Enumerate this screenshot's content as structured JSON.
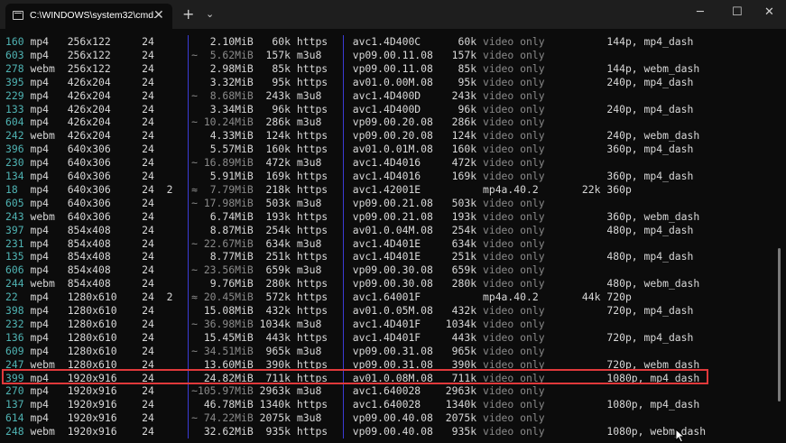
{
  "window": {
    "tab_title": "C:\\WINDOWS\\system32\\cmd.",
    "close_tab": "✕",
    "new_tab": "+",
    "dropdown": "⌄",
    "minimize": "─",
    "maximize": "☐",
    "close": "✕"
  },
  "separators": {
    "bar": "|",
    "tilde": "~",
    "approx": "≈"
  },
  "rows": [
    {
      "id": "160",
      "ext": "mp4",
      "res": "256x122",
      "fps": "24",
      "ch": "",
      "tilde": "",
      "size": "2.10MiB",
      "tbr": "60k",
      "proto": "https",
      "vcodec": "avc1.4D400C",
      "vbr": "60k",
      "acodec": "video only",
      "abr": "",
      "more": "144p, mp4_dash"
    },
    {
      "id": "603",
      "ext": "mp4",
      "res": "256x122",
      "fps": "24",
      "ch": "",
      "tilde": "~",
      "size": "5.62MiB",
      "tbr": "157k",
      "proto": "m3u8",
      "vcodec": "vp09.00.11.08",
      "vbr": "157k",
      "acodec": "video only",
      "abr": "",
      "more": ""
    },
    {
      "id": "278",
      "ext": "webm",
      "res": "256x122",
      "fps": "24",
      "ch": "",
      "tilde": "",
      "size": "2.98MiB",
      "tbr": "85k",
      "proto": "https",
      "vcodec": "vp09.00.11.08",
      "vbr": "85k",
      "acodec": "video only",
      "abr": "",
      "more": "144p, webm_dash"
    },
    {
      "id": "395",
      "ext": "mp4",
      "res": "426x204",
      "fps": "24",
      "ch": "",
      "tilde": "",
      "size": "3.32MiB",
      "tbr": "95k",
      "proto": "https",
      "vcodec": "av01.0.00M.08",
      "vbr": "95k",
      "acodec": "video only",
      "abr": "",
      "more": "240p, mp4_dash"
    },
    {
      "id": "229",
      "ext": "mp4",
      "res": "426x204",
      "fps": "24",
      "ch": "",
      "tilde": "~",
      "size": "8.68MiB",
      "tbr": "243k",
      "proto": "m3u8",
      "vcodec": "avc1.4D400D",
      "vbr": "243k",
      "acodec": "video only",
      "abr": "",
      "more": ""
    },
    {
      "id": "133",
      "ext": "mp4",
      "res": "426x204",
      "fps": "24",
      "ch": "",
      "tilde": "",
      "size": "3.34MiB",
      "tbr": "96k",
      "proto": "https",
      "vcodec": "avc1.4D400D",
      "vbr": "96k",
      "acodec": "video only",
      "abr": "",
      "more": "240p, mp4_dash"
    },
    {
      "id": "604",
      "ext": "mp4",
      "res": "426x204",
      "fps": "24",
      "ch": "",
      "tilde": "~",
      "size": "10.24MiB",
      "tbr": "286k",
      "proto": "m3u8",
      "vcodec": "vp09.00.20.08",
      "vbr": "286k",
      "acodec": "video only",
      "abr": "",
      "more": ""
    },
    {
      "id": "242",
      "ext": "webm",
      "res": "426x204",
      "fps": "24",
      "ch": "",
      "tilde": "",
      "size": "4.33MiB",
      "tbr": "124k",
      "proto": "https",
      "vcodec": "vp09.00.20.08",
      "vbr": "124k",
      "acodec": "video only",
      "abr": "",
      "more": "240p, webm_dash"
    },
    {
      "id": "396",
      "ext": "mp4",
      "res": "640x306",
      "fps": "24",
      "ch": "",
      "tilde": "",
      "size": "5.57MiB",
      "tbr": "160k",
      "proto": "https",
      "vcodec": "av01.0.01M.08",
      "vbr": "160k",
      "acodec": "video only",
      "abr": "",
      "more": "360p, mp4_dash"
    },
    {
      "id": "230",
      "ext": "mp4",
      "res": "640x306",
      "fps": "24",
      "ch": "",
      "tilde": "~",
      "size": "16.89MiB",
      "tbr": "472k",
      "proto": "m3u8",
      "vcodec": "avc1.4D4016",
      "vbr": "472k",
      "acodec": "video only",
      "abr": "",
      "more": ""
    },
    {
      "id": "134",
      "ext": "mp4",
      "res": "640x306",
      "fps": "24",
      "ch": "",
      "tilde": "",
      "size": "5.91MiB",
      "tbr": "169k",
      "proto": "https",
      "vcodec": "avc1.4D4016",
      "vbr": "169k",
      "acodec": "video only",
      "abr": "",
      "more": "360p, mp4_dash"
    },
    {
      "id": "18",
      "ext": "mp4",
      "res": "640x306",
      "fps": "24",
      "ch": "2",
      "tilde": "≈",
      "size": "7.79MiB",
      "tbr": "218k",
      "proto": "https",
      "vcodec": "avc1.42001E",
      "vbr": "",
      "acodec": "mp4a.40.2",
      "abr": "22k",
      "more": "360p"
    },
    {
      "id": "605",
      "ext": "mp4",
      "res": "640x306",
      "fps": "24",
      "ch": "",
      "tilde": "~",
      "size": "17.98MiB",
      "tbr": "503k",
      "proto": "m3u8",
      "vcodec": "vp09.00.21.08",
      "vbr": "503k",
      "acodec": "video only",
      "abr": "",
      "more": ""
    },
    {
      "id": "243",
      "ext": "webm",
      "res": "640x306",
      "fps": "24",
      "ch": "",
      "tilde": "",
      "size": "6.74MiB",
      "tbr": "193k",
      "proto": "https",
      "vcodec": "vp09.00.21.08",
      "vbr": "193k",
      "acodec": "video only",
      "abr": "",
      "more": "360p, webm_dash"
    },
    {
      "id": "397",
      "ext": "mp4",
      "res": "854x408",
      "fps": "24",
      "ch": "",
      "tilde": "",
      "size": "8.87MiB",
      "tbr": "254k",
      "proto": "https",
      "vcodec": "av01.0.04M.08",
      "vbr": "254k",
      "acodec": "video only",
      "abr": "",
      "more": "480p, mp4_dash"
    },
    {
      "id": "231",
      "ext": "mp4",
      "res": "854x408",
      "fps": "24",
      "ch": "",
      "tilde": "~",
      "size": "22.67MiB",
      "tbr": "634k",
      "proto": "m3u8",
      "vcodec": "avc1.4D401E",
      "vbr": "634k",
      "acodec": "video only",
      "abr": "",
      "more": ""
    },
    {
      "id": "135",
      "ext": "mp4",
      "res": "854x408",
      "fps": "24",
      "ch": "",
      "tilde": "",
      "size": "8.77MiB",
      "tbr": "251k",
      "proto": "https",
      "vcodec": "avc1.4D401E",
      "vbr": "251k",
      "acodec": "video only",
      "abr": "",
      "more": "480p, mp4_dash"
    },
    {
      "id": "606",
      "ext": "mp4",
      "res": "854x408",
      "fps": "24",
      "ch": "",
      "tilde": "~",
      "size": "23.56MiB",
      "tbr": "659k",
      "proto": "m3u8",
      "vcodec": "vp09.00.30.08",
      "vbr": "659k",
      "acodec": "video only",
      "abr": "",
      "more": ""
    },
    {
      "id": "244",
      "ext": "webm",
      "res": "854x408",
      "fps": "24",
      "ch": "",
      "tilde": "",
      "size": "9.76MiB",
      "tbr": "280k",
      "proto": "https",
      "vcodec": "vp09.00.30.08",
      "vbr": "280k",
      "acodec": "video only",
      "abr": "",
      "more": "480p, webm_dash"
    },
    {
      "id": "22",
      "ext": "mp4",
      "res": "1280x610",
      "fps": "24",
      "ch": "2",
      "tilde": "≈",
      "size": "20.45MiB",
      "tbr": "572k",
      "proto": "https",
      "vcodec": "avc1.64001F",
      "vbr": "",
      "acodec": "mp4a.40.2",
      "abr": "44k",
      "more": "720p"
    },
    {
      "id": "398",
      "ext": "mp4",
      "res": "1280x610",
      "fps": "24",
      "ch": "",
      "tilde": "",
      "size": "15.08MiB",
      "tbr": "432k",
      "proto": "https",
      "vcodec": "av01.0.05M.08",
      "vbr": "432k",
      "acodec": "video only",
      "abr": "",
      "more": "720p, mp4_dash"
    },
    {
      "id": "232",
      "ext": "mp4",
      "res": "1280x610",
      "fps": "24",
      "ch": "",
      "tilde": "~",
      "size": "36.98MiB",
      "tbr": "1034k",
      "proto": "m3u8",
      "vcodec": "avc1.4D401F",
      "vbr": "1034k",
      "acodec": "video only",
      "abr": "",
      "more": ""
    },
    {
      "id": "136",
      "ext": "mp4",
      "res": "1280x610",
      "fps": "24",
      "ch": "",
      "tilde": "",
      "size": "15.45MiB",
      "tbr": "443k",
      "proto": "https",
      "vcodec": "avc1.4D401F",
      "vbr": "443k",
      "acodec": "video only",
      "abr": "",
      "more": "720p, mp4_dash"
    },
    {
      "id": "609",
      "ext": "mp4",
      "res": "1280x610",
      "fps": "24",
      "ch": "",
      "tilde": "~",
      "size": "34.51MiB",
      "tbr": "965k",
      "proto": "m3u8",
      "vcodec": "vp09.00.31.08",
      "vbr": "965k",
      "acodec": "video only",
      "abr": "",
      "more": ""
    },
    {
      "id": "247",
      "ext": "webm",
      "res": "1280x610",
      "fps": "24",
      "ch": "",
      "tilde": "",
      "size": "13.60MiB",
      "tbr": "390k",
      "proto": "https",
      "vcodec": "vp09.00.31.08",
      "vbr": "390k",
      "acodec": "video only",
      "abr": "",
      "more": "720p, webm_dash"
    },
    {
      "id": "399",
      "ext": "mp4",
      "res": "1920x916",
      "fps": "24",
      "ch": "",
      "tilde": "",
      "size": "24.82MiB",
      "tbr": "711k",
      "proto": "https",
      "vcodec": "av01.0.08M.08",
      "vbr": "711k",
      "acodec": "video only",
      "abr": "",
      "more": "1080p, mp4_dash"
    },
    {
      "id": "270",
      "ext": "mp4",
      "res": "1920x916",
      "fps": "24",
      "ch": "",
      "tilde": "~",
      "size": "105.97MiB",
      "tbr": "2963k",
      "proto": "m3u8",
      "vcodec": "avc1.640028",
      "vbr": "2963k",
      "acodec": "video only",
      "abr": "",
      "more": ""
    },
    {
      "id": "137",
      "ext": "mp4",
      "res": "1920x916",
      "fps": "24",
      "ch": "",
      "tilde": "",
      "size": "46.78MiB",
      "tbr": "1340k",
      "proto": "https",
      "vcodec": "avc1.640028",
      "vbr": "1340k",
      "acodec": "video only",
      "abr": "",
      "more": "1080p, mp4_dash"
    },
    {
      "id": "614",
      "ext": "mp4",
      "res": "1920x916",
      "fps": "24",
      "ch": "",
      "tilde": "~",
      "size": "74.22MiB",
      "tbr": "2075k",
      "proto": "m3u8",
      "vcodec": "vp09.00.40.08",
      "vbr": "2075k",
      "acodec": "video only",
      "abr": "",
      "more": ""
    },
    {
      "id": "248",
      "ext": "webm",
      "res": "1920x916",
      "fps": "24",
      "ch": "",
      "tilde": "",
      "size": "32.62MiB",
      "tbr": "935k",
      "proto": "https",
      "vcodec": "vp09.00.40.08",
      "vbr": "935k",
      "acodec": "video only",
      "abr": "",
      "more": "1080p, webm_dash"
    }
  ],
  "highlighted_row_id": "399",
  "colors": {
    "highlight_border": "#e0393b",
    "separator": "#3b3bd6",
    "id_color": "#4fb3b3",
    "text": "#d8d8d8",
    "dim": "#8a8a8a"
  }
}
